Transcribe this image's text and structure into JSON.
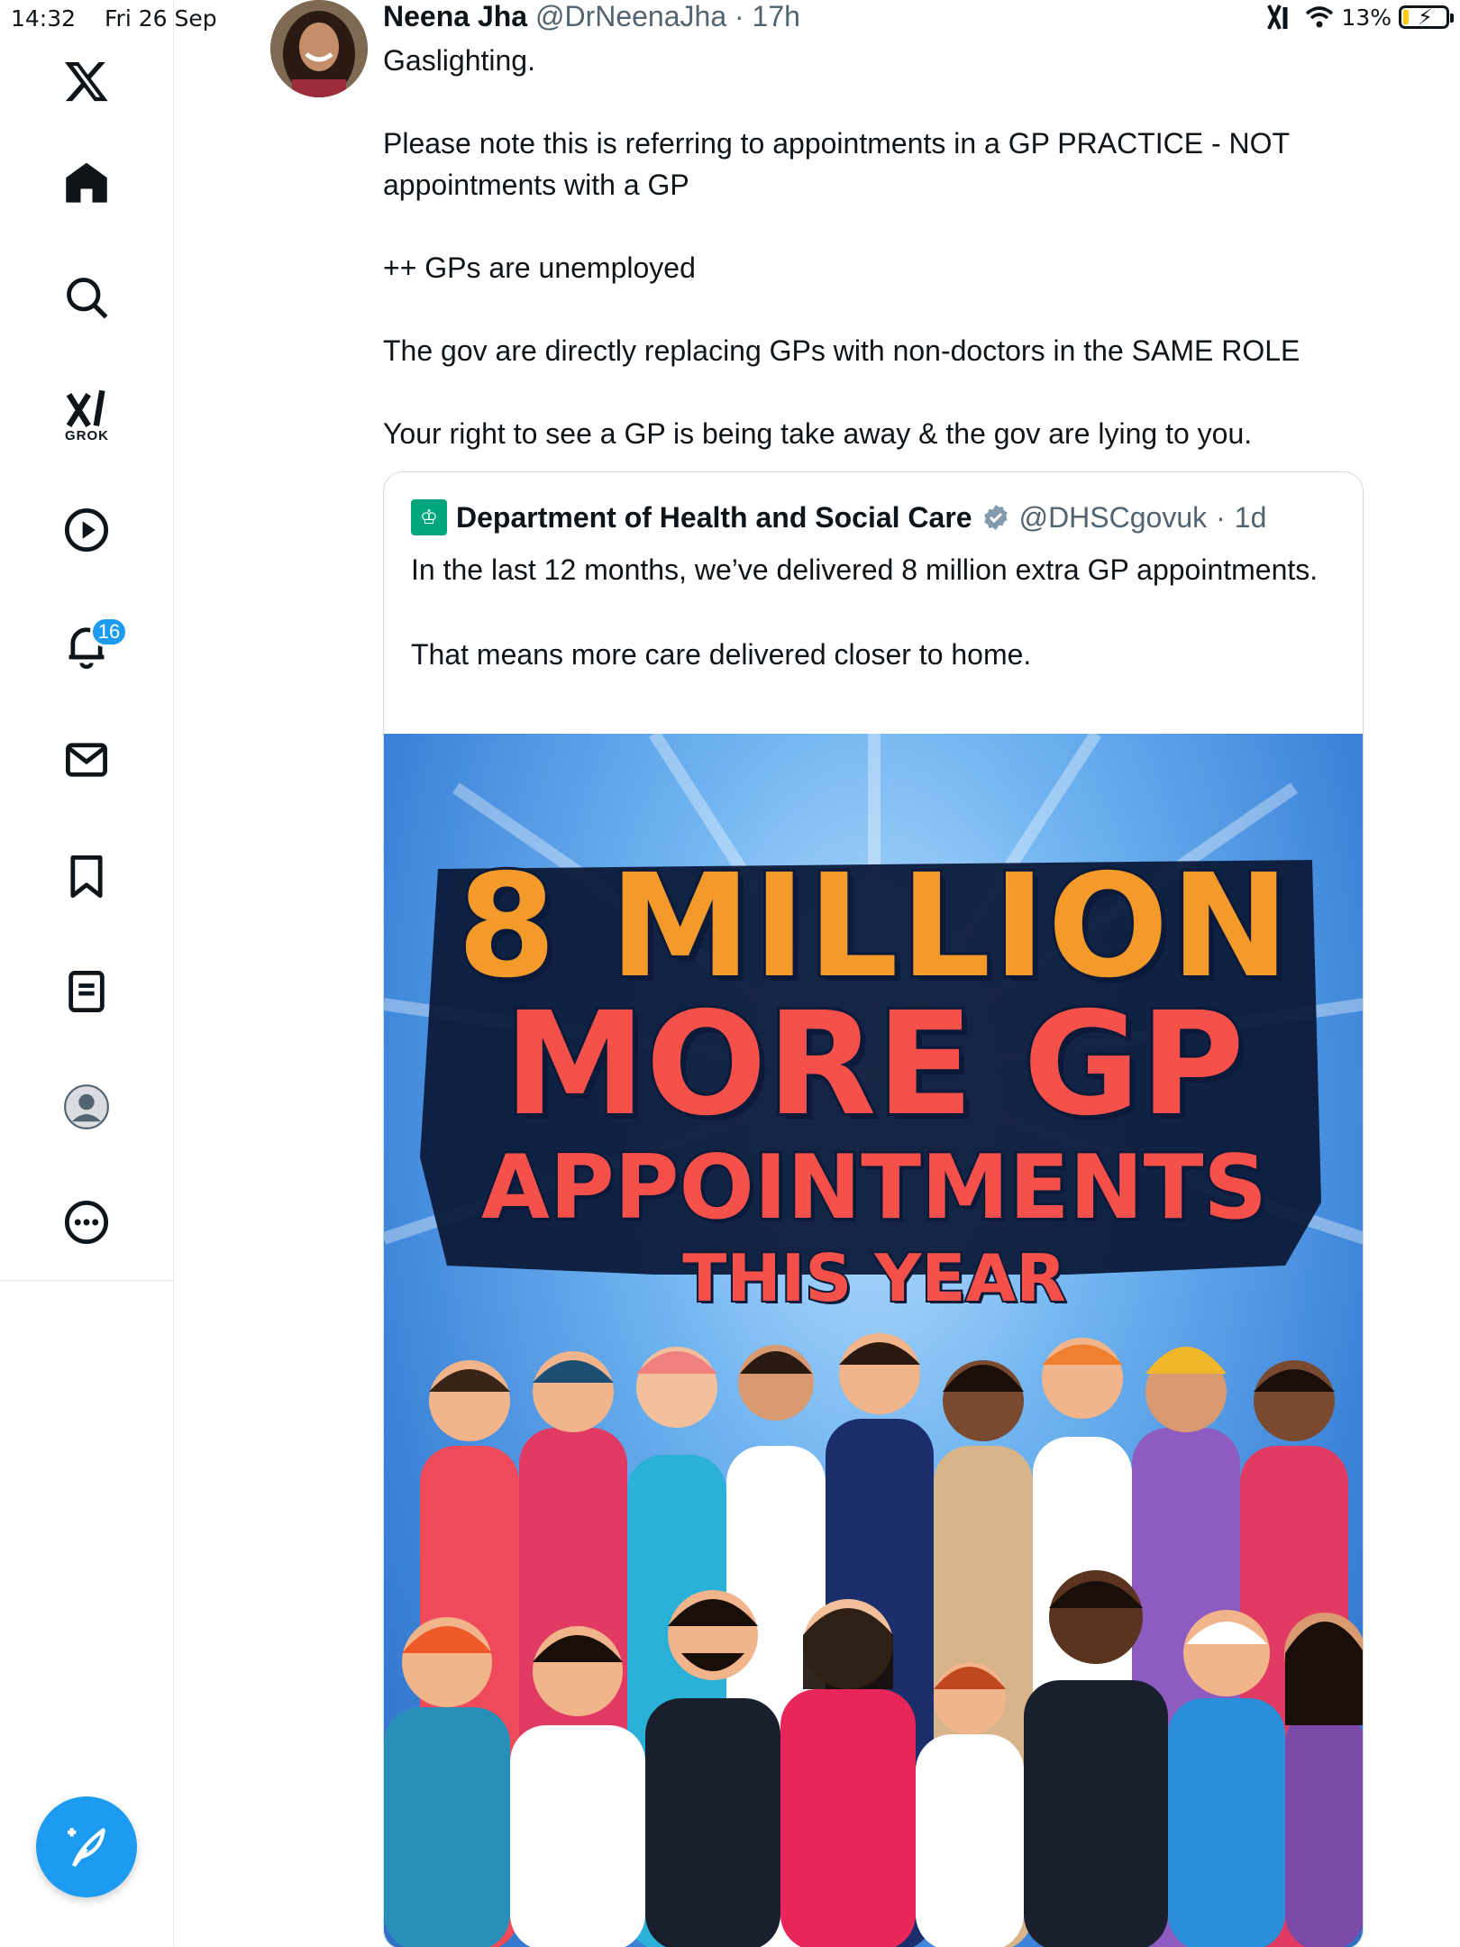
{
  "status_bar": {
    "time": "14:32",
    "date": "Fri 26 Sep",
    "battery": "13%"
  },
  "sidebar": {
    "items": [
      {
        "name": "x-logo"
      },
      {
        "name": "home"
      },
      {
        "name": "explore"
      },
      {
        "name": "grok",
        "label": "GROK"
      },
      {
        "name": "video"
      },
      {
        "name": "notifications",
        "badge": "16"
      },
      {
        "name": "messages"
      },
      {
        "name": "bookmarks"
      },
      {
        "name": "articles"
      },
      {
        "name": "profile"
      },
      {
        "name": "more"
      }
    ]
  },
  "tweet": {
    "author_name": "Neena Jha",
    "author_handle": "@DrNeenaJha",
    "time": "17h",
    "paragraphs": [
      "Gaslighting.",
      "Please note this is referring to appointments in a GP PRACTICE - NOT appointments with a GP",
      "++ GPs are unemployed",
      "The gov are directly replacing GPs with non-doctors in the SAME ROLE",
      "Your right to see a GP is being take away & the gov are lying to you."
    ]
  },
  "quote": {
    "author_name": "Department of Health and Social Care",
    "author_handle": "@DHSCgovuk",
    "time": "1d",
    "paragraphs": [
      "In the last 12 months, we’ve delivered 8 million extra GP appointments.",
      "That means more care delivered closer to home."
    ],
    "poster": {
      "line1": "8 MILLION",
      "line2": "MORE GP",
      "line3": "APPOINTMENTS",
      "line4": "THIS YEAR"
    }
  },
  "colors": {
    "accent": "#1d9bf0",
    "text": "#0f1419",
    "muted": "#536471",
    "poster_orange": "#f39a2b",
    "poster_red": "#f5514a"
  }
}
